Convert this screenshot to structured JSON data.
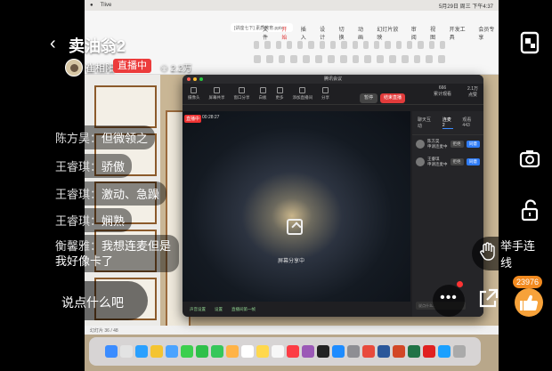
{
  "colors": {
    "live_red": "#ec3c3c",
    "like_orange": "#f28a1f",
    "meeting_accent": "#2f7cf6"
  },
  "desktop": {
    "menubar": {
      "app": "Tlive",
      "clock": "5月29日 周三 下午4:37"
    },
    "ppt": {
      "doc_tab": "[讲座七下] 素质教育.pptx",
      "tabs": [
        "文件",
        "开始",
        "插入",
        "设计",
        "切换",
        "动画",
        "幻灯片放映",
        "审阅",
        "视图",
        "开发工具",
        "会员专享"
      ],
      "active_tab": "开始",
      "statusbar": "幻灯片 36 / 48"
    },
    "dock_icons": [
      "finder-icon",
      "launchpad-icon",
      "safari-icon",
      "chrome-icon",
      "mail-icon",
      "messages-icon",
      "wechat-icon",
      "facetime-icon",
      "photos-icon",
      "calendar-icon",
      "notes-icon",
      "reminders-icon",
      "music-icon",
      "podcasts-icon",
      "tv-icon",
      "appstore-icon",
      "settings-icon",
      "wps-icon",
      "word-icon",
      "powerpoint-icon",
      "excel-icon",
      "netease-music-icon",
      "qq-icon",
      "trash-icon"
    ]
  },
  "meeting": {
    "title": "腾讯会议",
    "tools": [
      "摄像头",
      "屏幕共享",
      "窗口分享",
      "白板",
      "更多",
      "添加直播间",
      "分享"
    ],
    "pause_label": "暂停",
    "end_label": "结束直播",
    "stats": [
      {
        "value": "666",
        "label": "累计观看"
      },
      {
        "value": "2.1万",
        "label": "点赞"
      }
    ],
    "recording_badge": "直播中",
    "recording_time": "00:28:27",
    "share_label": "屏幕分享中",
    "footer_items": [
      "声音设置",
      "设置",
      "直播间第一帧"
    ],
    "panel_tabs": [
      "聊天互动",
      "连麦 2",
      "观看 443"
    ],
    "selected_panel_tab": "连麦 2",
    "panel_users": [
      {
        "name": "陈方昊",
        "sub": "申请连麦中",
        "reject": "拒绝",
        "accept": "同意"
      },
      {
        "name": "王睿琪",
        "sub": "申请连麦中",
        "reject": "拒绝",
        "accept": "同意"
      }
    ],
    "panel_input_placeholder": "说点什么..."
  },
  "live": {
    "host_name": "卖油翁2",
    "host_sub": "崔相阳",
    "live_tag": "直播中",
    "viewer_count": "2.2万",
    "comments": [
      {
        "user": "陈方昊：",
        "text": "但微领之"
      },
      {
        "user": "王睿琪：",
        "text": "骄傲"
      },
      {
        "user": "王睿琪：",
        "text": "激动、急躁"
      },
      {
        "user": "王睿琪：",
        "text": "娴熟"
      },
      {
        "user": "衡馨雅：",
        "text": "我想连麦但是我好像卡了"
      }
    ],
    "input_placeholder": "说点什么吧",
    "raise_hand_label": "举手连线",
    "like_count": "23976"
  }
}
